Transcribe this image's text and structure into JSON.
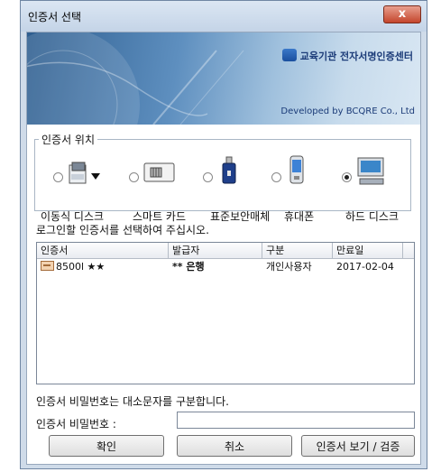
{
  "window": {
    "title": "인증서 선택",
    "close_glyph": "x"
  },
  "banner": {
    "brand": "교육기관 전자서명인증센터",
    "developed": "Developed by BCQRE Co., Ltd"
  },
  "location": {
    "legend": "인증서 위치",
    "selected": "하드 디스크",
    "devices": [
      {
        "label": "이동식 디스크",
        "icon": "removable-disk-icon"
      },
      {
        "label": "스마트 카드",
        "icon": "smart-card-icon"
      },
      {
        "label": "표준보안매체",
        "icon": "security-token-icon"
      },
      {
        "label": "휴대폰",
        "icon": "mobile-phone-icon"
      },
      {
        "label": "하드 디스크",
        "icon": "hard-disk-icon"
      }
    ]
  },
  "instruction": "로그인할 인증서를 선택하여 주십시오.",
  "cert_table": {
    "headers": [
      "인증서",
      "발급자",
      "구분",
      "만료일"
    ],
    "rows": [
      {
        "name": "8500l ★★",
        "issuer": "** 은행",
        "type": "개인사용자",
        "expiry": "2017-02-04"
      }
    ]
  },
  "note": "인증서 비밀번호는 대소문자를 구분합니다.",
  "password": {
    "label": "인증서 비밀번호 :",
    "value": ""
  },
  "buttons": {
    "confirm": "확인",
    "cancel": "취소",
    "view": "인증서 보기 / 검증"
  }
}
